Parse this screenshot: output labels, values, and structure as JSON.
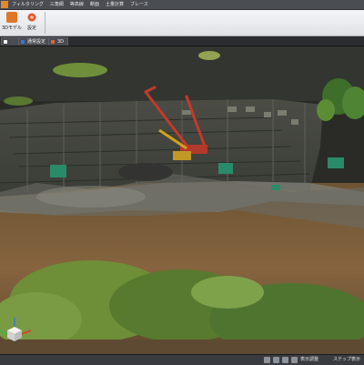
{
  "menubar": {
    "tabs": [
      "フィルタリング",
      "三角網",
      "等高線",
      "断面",
      "土量計算",
      "ブレース"
    ]
  },
  "ribbon": {
    "buttons": [
      {
        "label": "3Dモデル",
        "icon": "model-icon",
        "color": "#e0762a"
      },
      {
        "label": "設定",
        "icon": "gear-icon",
        "color": "#e4552c"
      }
    ]
  },
  "view_tabs": [
    {
      "label": "",
      "color": "#ffffff"
    },
    {
      "label": "通常設定",
      "color": "#3b78d8"
    },
    {
      "label": "3D",
      "color": "#e8632b"
    }
  ],
  "statusbar": {
    "items": [
      "表示調整",
      "ステップ表示"
    ]
  },
  "viewport": {
    "scene": "point-cloud construction site",
    "colors": {
      "ground": "#7a5a38",
      "building": "#4d5048",
      "crane": "#c23a2a",
      "vegetation": "#5e8a34"
    }
  }
}
